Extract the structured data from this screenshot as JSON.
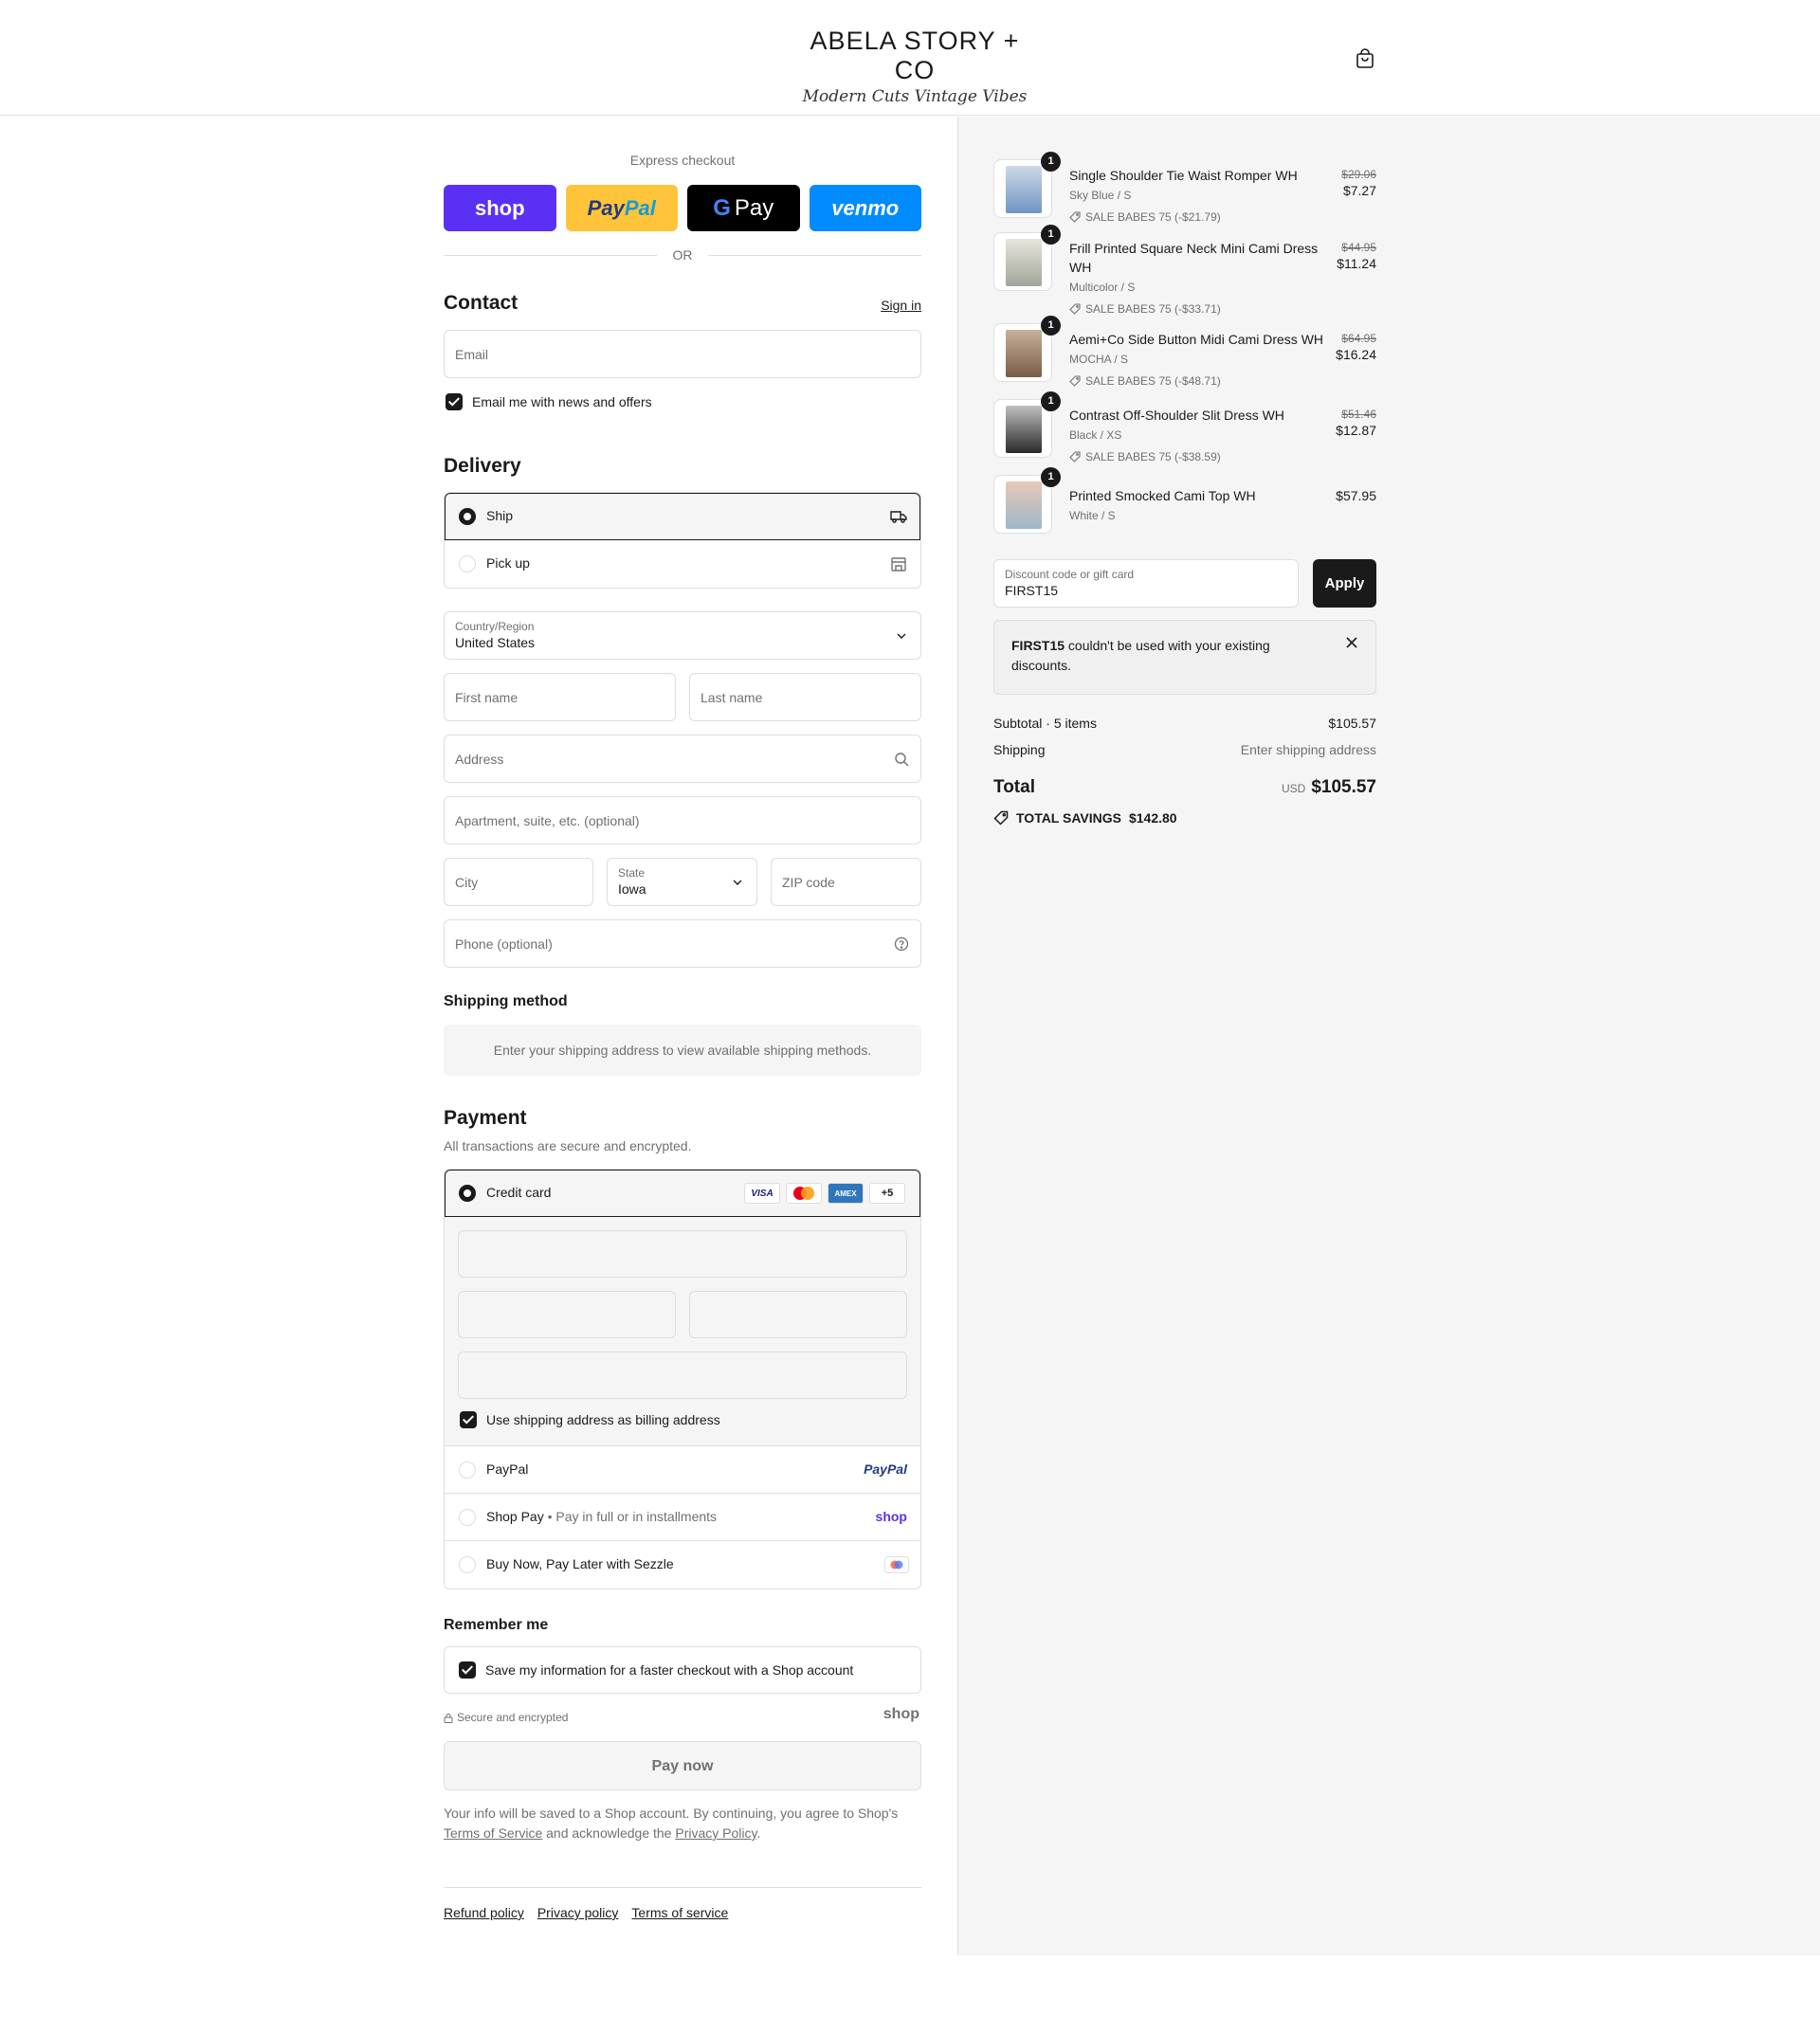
{
  "header": {
    "logo_main": "ABELA STORY + CO",
    "logo_sub": "Modern Cuts Vintage Vibes"
  },
  "express": {
    "title": "Express checkout",
    "shop": "shop",
    "paypal_a": "Pay",
    "paypal_b": "Pal",
    "gpay_g": "G",
    "gpay_text": "Pay",
    "venmo": "venmo",
    "or": "OR"
  },
  "contact": {
    "title": "Contact",
    "sign_in": "Sign in",
    "email_placeholder": "Email",
    "news_label": "Email me with news and offers"
  },
  "delivery": {
    "title": "Delivery",
    "ship": "Ship",
    "pickup": "Pick up",
    "country_label": "Country/Region",
    "country_value": "United States",
    "first_name": "First name",
    "last_name": "Last name",
    "address": "Address",
    "apartment": "Apartment, suite, etc. (optional)",
    "city": "City",
    "state_label": "State",
    "state_value": "Iowa",
    "zip": "ZIP code",
    "phone": "Phone (optional)"
  },
  "shipping_method": {
    "title": "Shipping method",
    "note": "Enter your shipping address to view available shipping methods."
  },
  "payment": {
    "title": "Payment",
    "subtitle": "All transactions are secure and encrypted.",
    "credit_card": "Credit card",
    "visa": "VISA",
    "amex": "AMEX",
    "more": "+5",
    "billing_same": "Use shipping address as billing address",
    "paypal": "PayPal",
    "paypal_mark": "PayPal",
    "shoppay": "Shop Pay",
    "shoppay_sub": "Pay in full or in installments",
    "shoppay_mark": "shop",
    "sezzle": "Buy Now, Pay Later with Sezzle"
  },
  "remember": {
    "title": "Remember me",
    "save_label": "Save my information for a faster checkout with a Shop account",
    "secure": "Secure and encrypted",
    "shop_mark": "shop"
  },
  "pay_now": "Pay now",
  "legal": {
    "text1": "Your info will be saved to a Shop account. By continuing, you agree to Shop's",
    "terms": "Terms of Service",
    "text2": "and acknowledge the",
    "privacy": "Privacy Policy",
    "period": "."
  },
  "footer": {
    "refund": "Refund policy",
    "privacy": "Privacy policy",
    "terms": "Terms of service"
  },
  "summary": {
    "items": [
      {
        "qty": "1",
        "name": "Single Shoulder Tie Waist Romper WH",
        "variant": "Sky Blue / S",
        "discount": "SALE BABES 75 (-$21.79)",
        "old_price": "$29.06",
        "price": "$7.27"
      },
      {
        "qty": "1",
        "name": "Frill Printed Square Neck Mini Cami Dress WH",
        "variant": "Multicolor / S",
        "discount": "SALE BABES 75 (-$33.71)",
        "old_price": "$44.95",
        "price": "$11.24"
      },
      {
        "qty": "1",
        "name": "Aemi+Co Side Button Midi Cami Dress WH",
        "variant": "MOCHA / S",
        "discount": "SALE BABES 75 (-$48.71)",
        "old_price": "$64.95",
        "price": "$16.24"
      },
      {
        "qty": "1",
        "name": "Contrast Off-Shoulder Slit Dress WH",
        "variant": "Black / XS",
        "discount": "SALE BABES 75 (-$38.59)",
        "old_price": "$51.46",
        "price": "$12.87"
      },
      {
        "qty": "1",
        "name": "Printed Smocked Cami Top WH",
        "variant": "White / S",
        "discount": "",
        "old_price": "",
        "price": "$57.95"
      }
    ],
    "discount_label": "Discount code or gift card",
    "discount_value": "FIRST15",
    "apply": "Apply",
    "error_code": "FIRST15",
    "error_text": "couldn't be used with your existing discounts.",
    "subtotal_label": "Subtotal · 5 items",
    "subtotal_value": "$105.57",
    "shipping_label": "Shipping",
    "shipping_value": "Enter shipping address",
    "total_label": "Total",
    "total_currency": "USD",
    "total_value": "$105.57",
    "savings_label": "TOTAL SAVINGS",
    "savings_value": "$142.80"
  }
}
